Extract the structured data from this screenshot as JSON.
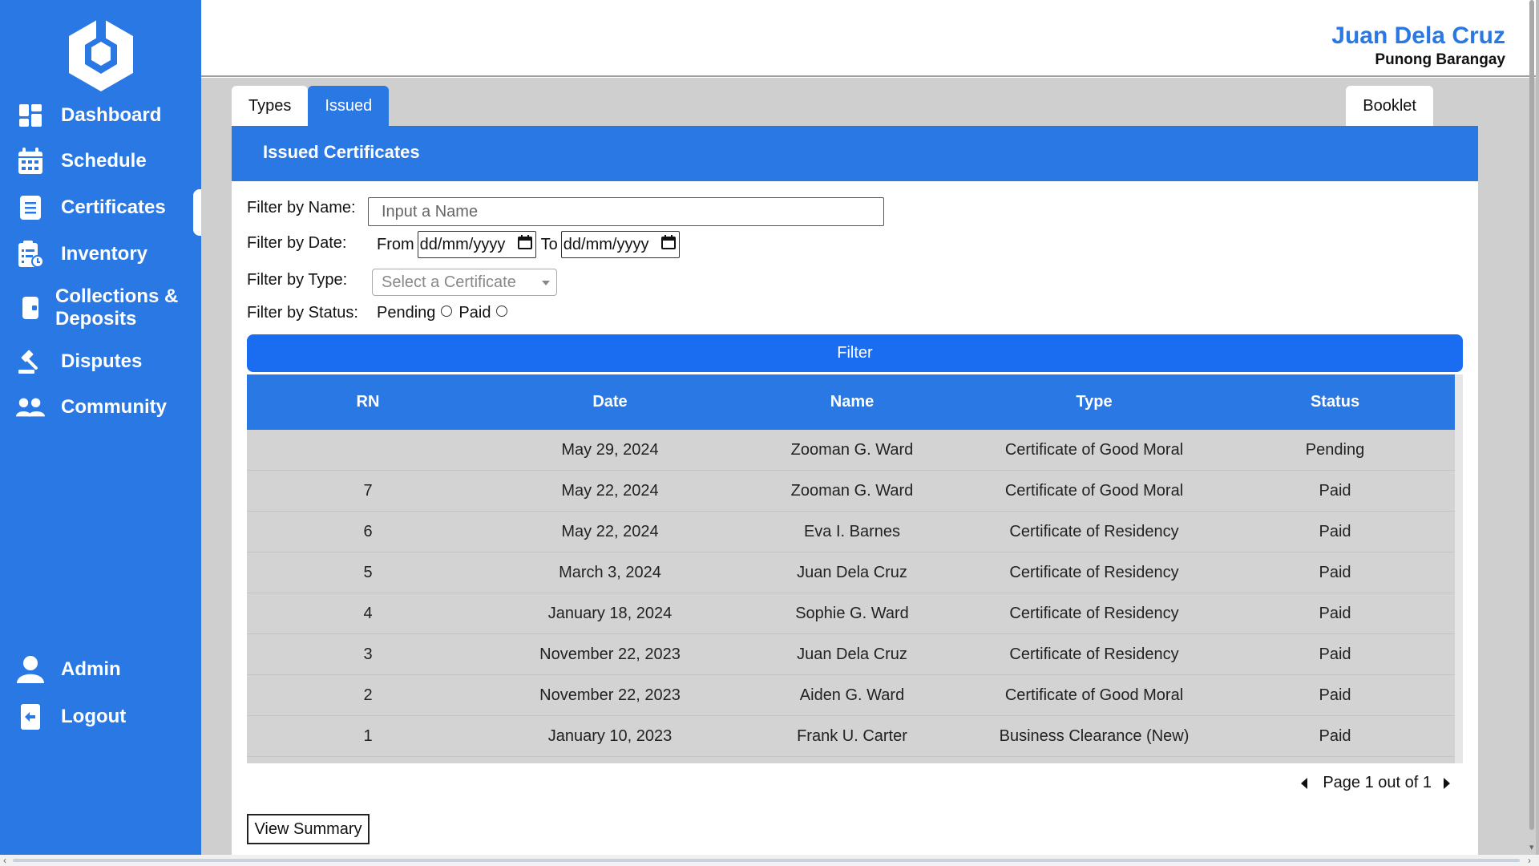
{
  "app": {
    "colors": {
      "primary": "#2a78e4",
      "filter_button": "#1a6cf0",
      "table_body": "#d3d3d3"
    }
  },
  "sidebar": {
    "logo_icon": "hexagon-logo-icon",
    "items": [
      {
        "label": "Dashboard",
        "icon": "dashboard-grid-icon"
      },
      {
        "label": "Schedule",
        "icon": "calendar-icon"
      },
      {
        "label": "Certificates",
        "icon": "document-icon",
        "active": true
      },
      {
        "label": "Inventory",
        "icon": "inventory-list-icon"
      },
      {
        "label": "Collections &",
        "label2": "Deposits",
        "icon": "wallet-icon"
      },
      {
        "label": "Disputes",
        "icon": "gavel-icon"
      },
      {
        "label": "Community",
        "icon": "users-icon"
      }
    ],
    "bottom_items": [
      {
        "label": "Admin",
        "icon": "user-icon"
      },
      {
        "label": "Logout",
        "icon": "logout-icon"
      }
    ]
  },
  "header": {
    "user_name": "Juan Dela Cruz",
    "user_role": "Punong Barangay"
  },
  "tabs": [
    {
      "label": "Types",
      "active": false
    },
    {
      "label": "Issued",
      "active": true
    }
  ],
  "tab_right": {
    "label": "Booklet"
  },
  "panel": {
    "title": "Issued Certificates"
  },
  "filters": {
    "name_label": "Filter by Name:",
    "name_placeholder": "Input a Name",
    "date_label": "Filter by Date:",
    "from_label": "From",
    "from_value": "dd/mm/yyyy",
    "to_label": "To",
    "to_value": "dd/mm/yyyy",
    "type_label": "Filter by Type:",
    "type_placeholder": "Select a Certificate",
    "status_label": "Filter by Status:",
    "status_pending": "Pending",
    "status_paid": "Paid",
    "filter_button": "Filter"
  },
  "table": {
    "columns": [
      "RN",
      "Date",
      "Name",
      "Type",
      "Status"
    ],
    "rows": [
      [
        "",
        "May 29, 2024",
        "Zooman G. Ward",
        "Certificate of Good Moral",
        "Pending"
      ],
      [
        "7",
        "May 22, 2024",
        "Zooman G. Ward",
        "Certificate of Good Moral",
        "Paid"
      ],
      [
        "6",
        "May 22, 2024",
        "Eva I. Barnes",
        "Certificate of Residency",
        "Paid"
      ],
      [
        "5",
        "March 3, 2024",
        "Juan Dela Cruz",
        "Certificate of Residency",
        "Paid"
      ],
      [
        "4",
        "January 18, 2024",
        "Sophie G. Ward",
        "Certificate of Residency",
        "Paid"
      ],
      [
        "3",
        "November 22, 2023",
        "Juan Dela Cruz",
        "Certificate of Residency",
        "Paid"
      ],
      [
        "2",
        "November 22, 2023",
        "Aiden G. Ward",
        "Certificate of Good Moral",
        "Paid"
      ],
      [
        "1",
        "January 10, 2023",
        "Frank U. Carter",
        "Business Clearance (New)",
        "Paid"
      ]
    ]
  },
  "pagination": {
    "text": "Page 1 out of 1"
  },
  "summary_button": "View Summary"
}
